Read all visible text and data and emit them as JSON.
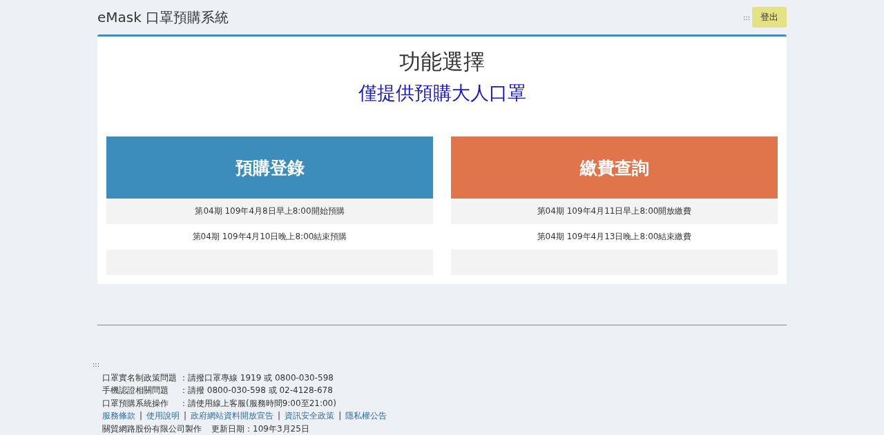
{
  "header": {
    "title": "eMask 口罩預購系統",
    "menu_glyph": ":::",
    "logout_button": "登出"
  },
  "panel": {
    "title": "功能選擇",
    "subtitle": "僅提供預購大人口罩",
    "cards": [
      {
        "title": "預購登錄",
        "color": "#3c8dbc",
        "rows": [
          "第04期 109年4月8日早上8:00開始預購",
          "第04期 109年4月10日晚上8:00結束預購",
          ""
        ]
      },
      {
        "title": "繳費查詢",
        "color": "#e0744a",
        "rows": [
          "第04期 109年4月11日早上8:00開放繳費",
          "第04期 109年4月13日晚上8:00結束繳費",
          ""
        ]
      }
    ]
  },
  "footer": {
    "glyph": ":::",
    "contacts": [
      {
        "label": "口罩實名制政策問題",
        "value": "：請撥口罩專線 1919 或 0800-030-598"
      },
      {
        "label": "手機認證相關問題",
        "value": "：請撥 0800-030-598 或 02-4128-678"
      },
      {
        "label": "口罩預購系統操作",
        "value": "：請使用線上客服(服務時間9:00至21:00)"
      }
    ],
    "links": [
      "服務條款",
      "使用說明",
      "政府網站資料開放宣告",
      "資訊安全政策",
      "隱私權公告"
    ],
    "separator": "|",
    "credit": "關貿網路股份有限公司製作",
    "updated": "更新日期：109年3月25日"
  }
}
